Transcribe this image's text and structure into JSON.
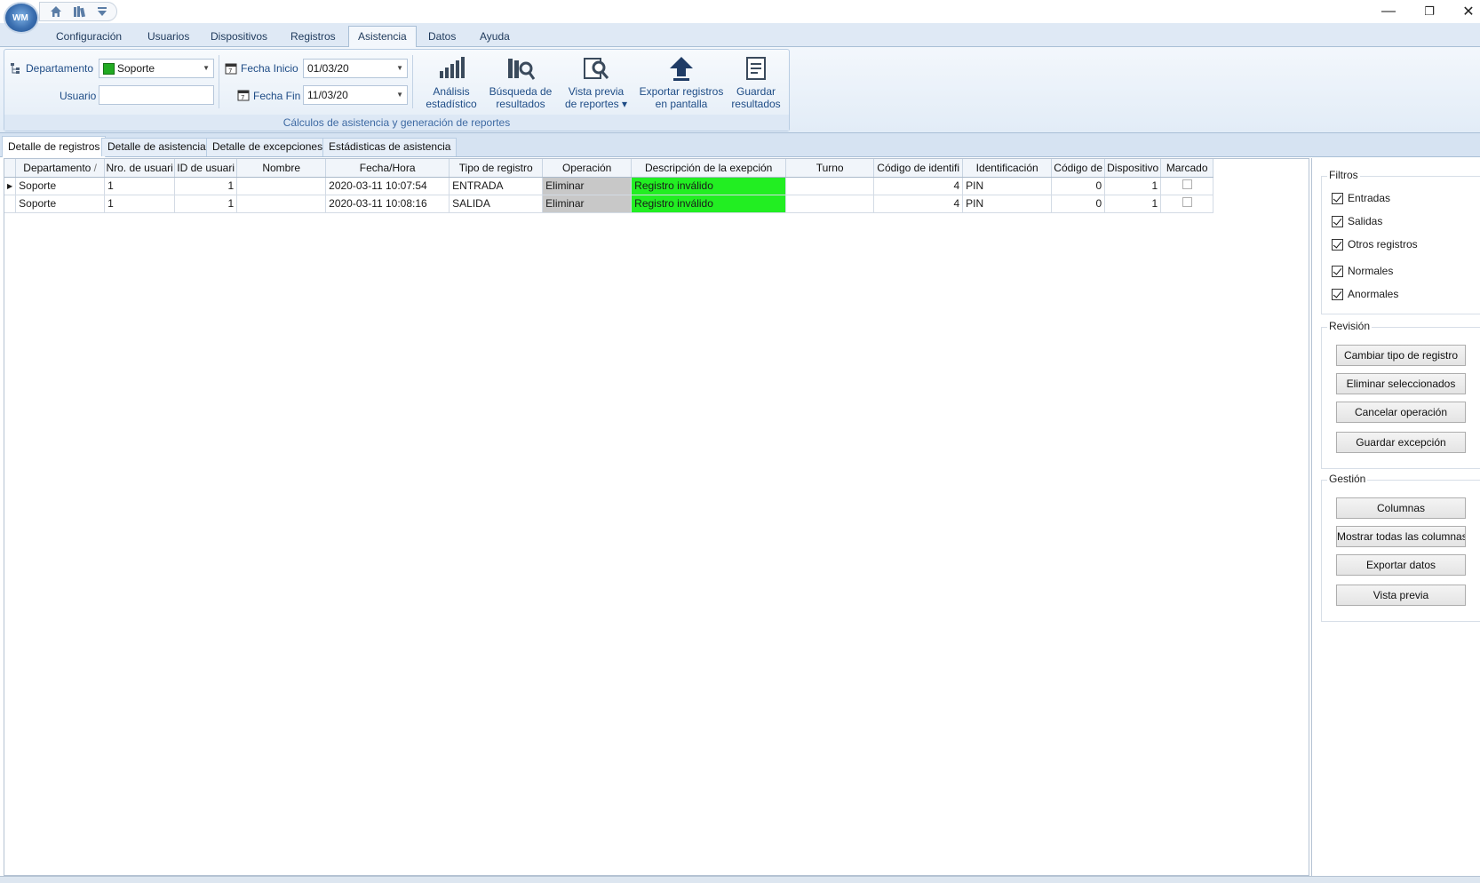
{
  "ribbon_tabs": [
    "Configuración",
    "Usuarios",
    "Dispositivos",
    "Registros",
    "Asistencia",
    "Datos",
    "Ayuda"
  ],
  "active_ribbon_tab": "Asistencia",
  "filters": {
    "department_label": "Departamento",
    "department_value": "Soporte",
    "department_color": "#22aa22",
    "user_label": "Usuario",
    "user_value": "",
    "start_label": "Fecha Inicio",
    "start_value": "01/03/20",
    "end_label": "Fecha Fin",
    "end_value": "11/03/20"
  },
  "ribbon_buttons": [
    {
      "l1": "Análisis",
      "l2": "estadístico",
      "icon": "bar-chart-icon"
    },
    {
      "l1": "Búsqueda de",
      "l2": "resultados",
      "icon": "books-search-icon"
    },
    {
      "l1": "Vista previa",
      "l2": "de reportes ▾",
      "icon": "preview-search-icon"
    },
    {
      "l1": "Exportar registros",
      "l2": "en pantalla",
      "icon": "export-arrow-icon"
    },
    {
      "l1": "Guardar",
      "l2": "resultados",
      "icon": "save-report-icon"
    }
  ],
  "group_caption": "Cálculos de asistencia y generación de reportes",
  "content_tabs": [
    "Detalle de registros",
    "Detalle de asistencia",
    "Detalle de excepciones",
    "Estádisticas de asistencia"
  ],
  "grid": {
    "columns": [
      "Departamento",
      "Nro. de usuari",
      "ID de usuari",
      "Nombre",
      "Fecha/Hora",
      "Tipo de registro",
      "Operación",
      "Descripción de la exepción",
      "Turno",
      "Código de identifi",
      "Identificación",
      "Código de",
      "Dispositivo",
      "Marcado"
    ],
    "rows": [
      [
        "Soporte",
        "1",
        "1",
        "",
        "2020-03-11 10:07:54",
        "ENTRADA",
        "Eliminar",
        "Registro inválido",
        "",
        "4",
        "PIN",
        "0",
        "1",
        ""
      ],
      [
        "Soporte",
        "1",
        "1",
        "",
        "2020-03-11 10:08:16",
        "SALIDA",
        "Eliminar",
        "Registro inválido",
        "",
        "4",
        "PIN",
        "0",
        "1",
        ""
      ]
    ],
    "sort_indicator": "/"
  },
  "panel": {
    "filtros_title": "Filtros",
    "filtros": [
      "Entradas",
      "Salidas",
      "Otros registros",
      "Normales",
      "Anormales"
    ],
    "revision_title": "Revisión",
    "revision_buttons": [
      "Cambiar tipo de registro",
      "Eliminar seleccionados",
      "Cancelar operación",
      "Guardar excepción"
    ],
    "gestion_title": "Gestión",
    "gestion_buttons": [
      "Columnas",
      "Mostrar todas las columnas",
      "Exportar datos",
      "Vista previa"
    ]
  },
  "window_controls": {
    "minimize": "—",
    "restore": "❐",
    "close": "✕"
  }
}
